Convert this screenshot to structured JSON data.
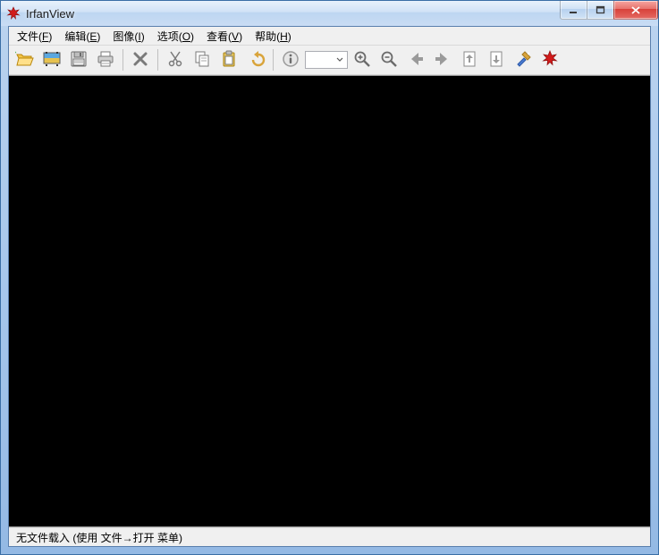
{
  "title": "IrfanView",
  "menu": {
    "file": {
      "label": "文件(",
      "mn": "F",
      "tail": ")"
    },
    "edit": {
      "label": "编辑(",
      "mn": "E",
      "tail": ")"
    },
    "image": {
      "label": "图像(",
      "mn": "I",
      "tail": ")"
    },
    "options": {
      "label": "选项(",
      "mn": "O",
      "tail": ")"
    },
    "view": {
      "label": "查看(",
      "mn": "V",
      "tail": ")"
    },
    "help": {
      "label": "帮助(",
      "mn": "H",
      "tail": ")"
    }
  },
  "page_input": "",
  "status": "无文件载入 (使用 文件→打开 菜单)"
}
